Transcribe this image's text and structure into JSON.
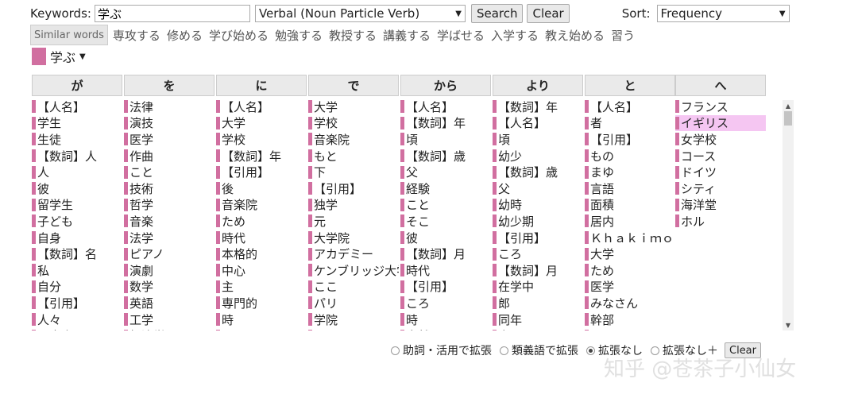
{
  "search": {
    "keywords_label": "Keywords:",
    "keywords_value": "学ぶ",
    "verbal_select": "Verbal (Noun Particle Verb)",
    "search_button": "Search",
    "clear_button": "Clear",
    "sort_label": "Sort:",
    "sort_select": "Frequency"
  },
  "similar": {
    "label": "Similar words",
    "words": [
      "専攻する",
      "修める",
      "学び始める",
      "勉強する",
      "教授する",
      "講義する",
      "学ばせる",
      "入学する",
      "教え始める",
      "習う"
    ]
  },
  "target_word": "学ぶ",
  "columns": [
    {
      "header": "が",
      "items": [
        "【人名】",
        "学生",
        "生徒",
        "【数詞】人",
        "人",
        "彼",
        "留学生",
        "子ども",
        "自身",
        "【数詞】名",
        "私",
        "自分",
        "【引用】",
        "人々",
        "日本人"
      ]
    },
    {
      "header": "を",
      "items": [
        "法律",
        "演技",
        "医学",
        "作曲",
        "こと",
        "技術",
        "哲学",
        "音楽",
        "法学",
        "ピアノ",
        "演劇",
        "数学",
        "英語",
        "工学",
        "経済学"
      ]
    },
    {
      "header": "に",
      "items": [
        "【人名】",
        "大学",
        "学校",
        "【数詞】年",
        "【引用】",
        "後",
        "音楽院",
        "ため",
        "時代",
        "本格的",
        "中心",
        "主",
        "専門的",
        "時",
        "クレッシェンド"
      ]
    },
    {
      "header": "で",
      "items": [
        "大学",
        "学校",
        "音楽院",
        "もと",
        "下",
        "【引用】",
        "独学",
        "元",
        "大学院",
        "アカデミー",
        "ケンブリッジ大学",
        "ここ",
        "パリ",
        "学院",
        "カレッジ"
      ]
    },
    {
      "header": "から",
      "items": [
        "【人名】",
        "【数詞】年",
        "頃",
        "【数詞】歳",
        "父",
        "経験",
        "こと",
        "そこ",
        "彼",
        "【数詞】月",
        "時代",
        "【引用】",
        "ころ",
        "時",
        "自然"
      ]
    },
    {
      "header": "より",
      "items": [
        "【数詞】年",
        "【人名】",
        "頃",
        "幼少",
        "【数詞】歳",
        "父",
        "幼時",
        "幼少期",
        "【引用】",
        "ころ",
        "【数詞】月",
        "在学中",
        "郎",
        "同年",
        "春"
      ]
    },
    {
      "header": "と",
      "items": [
        "【人名】",
        "者",
        "【引用】",
        "もの",
        "まゆ",
        "言語",
        "面積",
        "居内",
        "Ｋｈａｋｉｍｏｖ",
        "大学",
        "ため",
        "医学",
        "みなさん",
        "幹部",
        "キース"
      ]
    },
    {
      "header": "へ",
      "items": [
        "フランス",
        "イギリス",
        "女学校",
        "コース",
        "ドイツ",
        "シティ",
        "海洋堂",
        "ホル"
      ]
    }
  ],
  "options": {
    "radio1": "助詞・活用で拡張",
    "radio2": "類義語で拡張",
    "radio3": "拡張なし",
    "radio4": "拡張なし＋",
    "clear_small": "Clear"
  },
  "watermark": "知乎 @苍茶子小仙女",
  "colors": {
    "accent": "#d16fa0",
    "highlight": "#f5c6f2"
  }
}
